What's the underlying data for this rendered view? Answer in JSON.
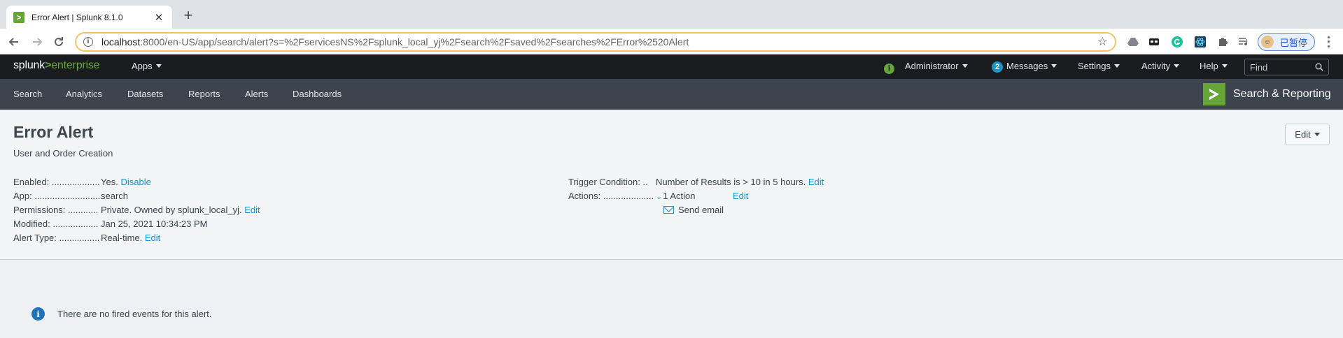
{
  "browser": {
    "tab_title": "Error Alert | Splunk 8.1.0",
    "tab_close": "✕",
    "new_tab": "+",
    "url_host": "localhost",
    "url_path": ":8000/en-US/app/search/alert?s=%2FservicesNS%2Fsplunk_local_yj%2Fsearch%2Fsaved%2Fsearches%2FError%2520Alert",
    "profile_label": "已暂停"
  },
  "splunk_bar": {
    "logo_a": "splunk",
    "logo_gt": ">",
    "logo_b": "enterprise",
    "apps": "Apps",
    "admin": "Administrator",
    "messages_count": "2",
    "messages": "Messages",
    "settings": "Settings",
    "activity": "Activity",
    "help": "Help",
    "find_placeholder": "Find"
  },
  "app_bar": {
    "items": [
      "Search",
      "Analytics",
      "Datasets",
      "Reports",
      "Alerts",
      "Dashboards"
    ],
    "app_name": "Search & Reporting"
  },
  "alert": {
    "title": "Error Alert",
    "description": "User and Order Creation",
    "edit_button": "Edit",
    "left": {
      "enabled_label": "Enabled: ...................",
      "enabled_value": "Yes.",
      "enabled_link": "Disable",
      "app_label": "App: ............................",
      "app_value": "search",
      "permissions_label": "Permissions: ............",
      "permissions_value": "Private. Owned by splunk_local_yj.",
      "permissions_link": "Edit",
      "modified_label": "Modified: ..................",
      "modified_value": "Jan 25, 2021 10:34:23 PM",
      "alert_type_label": "Alert Type: ................",
      "alert_type_value": "Real-time.",
      "alert_type_link": "Edit"
    },
    "right": {
      "trigger_label": "Trigger Condition: ..",
      "trigger_value": "Number of Results is > 10 in 5 hours.",
      "trigger_link": "Edit",
      "actions_label": "Actions: ....................",
      "actions_value": "1 Action",
      "actions_link": "Edit",
      "action_item": "Send email"
    }
  },
  "notice": "There are no fired events for this alert.",
  "colors": {
    "accent_green": "#65a637",
    "link_blue": "#1e93c6",
    "appbar": "#3c444d",
    "splunkbar": "#1a1c20"
  }
}
